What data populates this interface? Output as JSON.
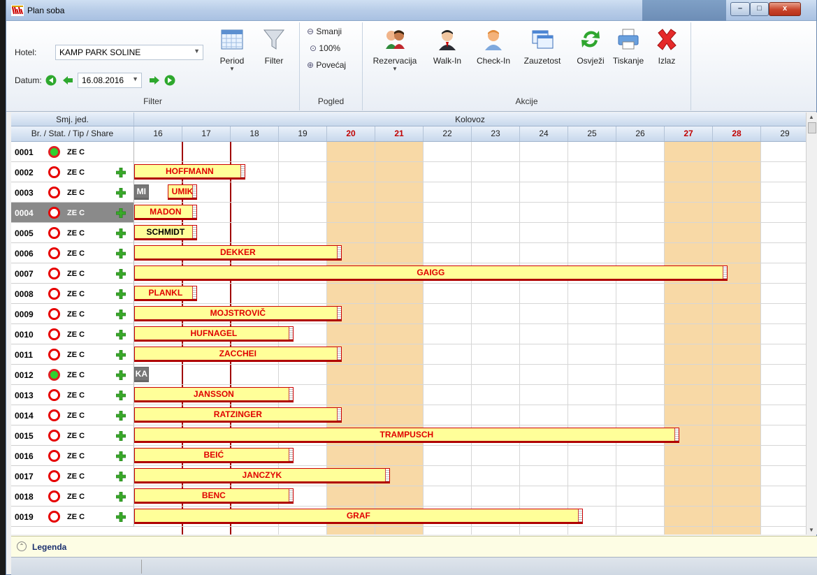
{
  "window": {
    "title": "Plan soba",
    "minimize": "–",
    "maximize": "□",
    "close": "x"
  },
  "filter": {
    "hotel_label": "Hotel:",
    "hotel_value": "KAMP PARK SOLINE",
    "datum_label": "Datum:",
    "datum_value": "16.08.2016",
    "period_label": "Period",
    "filter_label": "Filter",
    "group_label": "Filter"
  },
  "pogled": {
    "smanji": "Smanji",
    "zoom": "100%",
    "povecaj": "Povećaj",
    "group_label": "Pogled"
  },
  "akcije": {
    "rezervacija": "Rezervacija",
    "walkin": "Walk-In",
    "checkin": "Check-In",
    "zauzetost": "Zauzetost",
    "osvjezi": "Osvježi",
    "tiskanje": "Tiskanje",
    "izlaz": "Izlaz",
    "group_label": "Akcije"
  },
  "grid": {
    "unit_header": "Smj. jed.",
    "columns_header": "Br. / Stat. / Tip / Share",
    "month": "Kolovoz",
    "days": [
      "16",
      "17",
      "18",
      "19",
      "20",
      "21",
      "22",
      "23",
      "24",
      "25",
      "26",
      "27",
      "28",
      "29"
    ],
    "weekend_days": [
      "20",
      "21",
      "27",
      "28"
    ]
  },
  "rows": [
    {
      "num": "0001",
      "status": "ok",
      "tip": "ZE C",
      "plus": false
    },
    {
      "num": "0002",
      "status": "red",
      "tip": "ZE C",
      "plus": true
    },
    {
      "num": "0003",
      "status": "red",
      "tip": "ZE C",
      "plus": true
    },
    {
      "num": "0004",
      "status": "red",
      "tip": "ZE C",
      "plus": true,
      "selected": true
    },
    {
      "num": "0005",
      "status": "red",
      "tip": "ZE C",
      "plus": true
    },
    {
      "num": "0006",
      "status": "red",
      "tip": "ZE C",
      "plus": true
    },
    {
      "num": "0007",
      "status": "red",
      "tip": "ZE C",
      "plus": true
    },
    {
      "num": "0008",
      "status": "red",
      "tip": "ZE C",
      "plus": true
    },
    {
      "num": "0009",
      "status": "red",
      "tip": "ZE C",
      "plus": true
    },
    {
      "num": "0010",
      "status": "red",
      "tip": "ZE C",
      "plus": true
    },
    {
      "num": "0011",
      "status": "red",
      "tip": "ZE C",
      "plus": true
    },
    {
      "num": "0012",
      "status": "ok",
      "tip": "ZE C",
      "plus": true
    },
    {
      "num": "0013",
      "status": "red",
      "tip": "ZE C",
      "plus": true
    },
    {
      "num": "0014",
      "status": "red",
      "tip": "ZE C",
      "plus": true
    },
    {
      "num": "0015",
      "status": "red",
      "tip": "ZE C",
      "plus": true
    },
    {
      "num": "0016",
      "status": "red",
      "tip": "ZE C",
      "plus": true
    },
    {
      "num": "0017",
      "status": "red",
      "tip": "ZE C",
      "plus": true
    },
    {
      "num": "0018",
      "status": "red",
      "tip": "ZE C",
      "plus": true
    },
    {
      "num": "0019",
      "status": "red",
      "tip": "ZE C",
      "plus": true
    }
  ],
  "bookings": [
    {
      "row": 1,
      "name": "HOFFMANN",
      "start": 16,
      "end": 18.3
    },
    {
      "row": 2,
      "name": "MI",
      "start": 16,
      "end": 16.3,
      "gray": true
    },
    {
      "row": 2,
      "name": "UMIK",
      "start": 16.7,
      "end": 17.3
    },
    {
      "row": 3,
      "name": "MADON",
      "start": 16,
      "end": 17.3
    },
    {
      "row": 4,
      "name": "SCHMIDT",
      "start": 16,
      "end": 17.3,
      "black": true
    },
    {
      "row": 5,
      "name": "DEKKER",
      "start": 16,
      "end": 20.3
    },
    {
      "row": 6,
      "name": "GAIGG",
      "start": 16,
      "end": 28.3
    },
    {
      "row": 7,
      "name": "PLANKL",
      "start": 16,
      "end": 17.3
    },
    {
      "row": 8,
      "name": "MOJSTROVIČ",
      "start": 16,
      "end": 20.3
    },
    {
      "row": 9,
      "name": "HUFNAGEL",
      "start": 16,
      "end": 19.3
    },
    {
      "row": 10,
      "name": "ZACCHEI",
      "start": 16,
      "end": 20.3
    },
    {
      "row": 11,
      "name": "KA",
      "start": 16,
      "end": 16.3,
      "gray": true
    },
    {
      "row": 12,
      "name": "JANSSON",
      "start": 16,
      "end": 19.3
    },
    {
      "row": 13,
      "name": "RATZINGER",
      "start": 16,
      "end": 20.3
    },
    {
      "row": 14,
      "name": "TRAMPUSCH",
      "start": 16,
      "end": 27.3
    },
    {
      "row": 15,
      "name": "BEIĆ",
      "start": 16,
      "end": 19.3
    },
    {
      "row": 16,
      "name": "JANCZYK",
      "start": 16,
      "end": 21.3
    },
    {
      "row": 17,
      "name": "BENC",
      "start": 16,
      "end": 19.3
    },
    {
      "row": 18,
      "name": "GRAF",
      "start": 16,
      "end": 25.3
    }
  ],
  "legend": {
    "label": "Legenda"
  },
  "colors": {
    "weekend": "#f8d9a6",
    "booking_fill": "#ffff99",
    "booking_text": "#e00000"
  }
}
